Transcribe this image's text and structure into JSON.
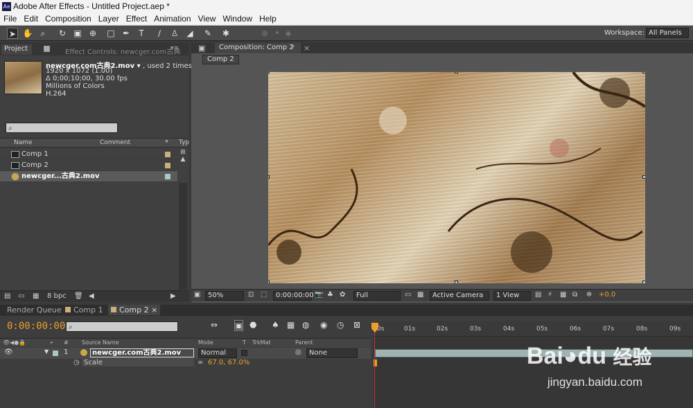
{
  "app": {
    "title": "Adobe After Effects - Untitled Project.aep *",
    "logo": "Ae"
  },
  "menu": [
    "File",
    "Edit",
    "Composition",
    "Layer",
    "Effect",
    "Animation",
    "View",
    "Window",
    "Help"
  ],
  "toolbar": {
    "workspace_label": "Workspace:",
    "workspace_value": "All Panels",
    "tools": [
      "selection-tool-icon",
      "hand-tool-icon",
      "zoom-tool-icon",
      "rotation-tool-icon",
      "camera-tool-icon",
      "pan-behind-tool-icon",
      "rectangle-tool-icon",
      "pen-tool-icon",
      "type-tool-icon",
      "brush-tool-icon",
      "clone-stamp-tool-icon",
      "eraser-tool-icon",
      "roto-brush-tool-icon",
      "puppet-tool-icon"
    ]
  },
  "project_panel": {
    "tab_project": "Project",
    "tab_effect_controls": "Effect Controls: newcger.com古典",
    "selected_name": "newcger.com古典2.mov",
    "used": ", used 2 times",
    "info": [
      "1920 x 1072 (1.00)",
      "Δ 0;00;10;00, 30.00 fps",
      "Millions of Colors",
      "H.264"
    ],
    "columns": {
      "name": "Name",
      "comment": "Comment",
      "type": "Typ"
    },
    "items": [
      {
        "name": "Comp 1",
        "color": "#c8b07a"
      },
      {
        "name": "Comp 2",
        "color": "#c8b07a"
      },
      {
        "name": "newcger...古典2.mov",
        "color": "#a8c8c8"
      }
    ],
    "bpc": "8 bpc"
  },
  "comp_panel": {
    "tab": "Composition: Comp 2",
    "sub_tab": "Comp 2",
    "footer": {
      "zoom": "50%",
      "timecode": "0:00:00:00",
      "resolution": "Full",
      "camera": "Active Camera",
      "view": "1 View",
      "exposure": "+0.0"
    }
  },
  "timeline": {
    "tabs": [
      "Render Queue",
      "Comp 1",
      "Comp 2"
    ],
    "timecode": "0:00:00:00",
    "columns": {
      "source": "Source Name",
      "mode": "Mode",
      "t": "T",
      "trkmat": "TrkMat",
      "parent": "Parent"
    },
    "layer": {
      "index": "1",
      "name": "newcger.com古典2.mov",
      "mode": "Normal",
      "parent": "None"
    },
    "property": {
      "name": "Scale",
      "value": "67.0, 67.0%"
    },
    "ruler": [
      "0s",
      "01s",
      "02s",
      "03s",
      "04s",
      "05s",
      "06s",
      "07s",
      "08s",
      "09s"
    ],
    "colors": {
      "timecode": "#e9a12b",
      "bar": "#9fb3b2"
    }
  },
  "watermark": {
    "brand": "Bai",
    "brand2": "du",
    "cn": "经验",
    "url": "jingyan.baidu.com"
  }
}
